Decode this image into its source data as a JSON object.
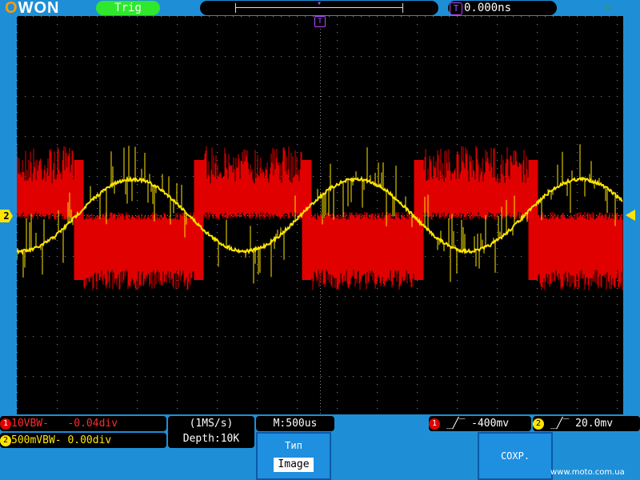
{
  "header": {
    "brand": "OWON",
    "trigger_status": "Trig",
    "trigger_position_badge": "T",
    "trigger_time": "0.000ns",
    "trigger_marker": "T"
  },
  "colors": {
    "ch1": "#e10000",
    "ch2": "#ffe600",
    "trigger": "#b14cff",
    "background": "#1e8fd6"
  },
  "screen": {
    "ch2_marker": "2",
    "ch1_waveform": "square wave with noise",
    "ch2_waveform": "sine wave with noise"
  },
  "channels": {
    "ch1": {
      "badge": "1",
      "text": "10VBW-",
      "offset": "-0.04div"
    },
    "ch2": {
      "badge": "2",
      "text": "500mVBW-",
      "offset": "0.00div"
    }
  },
  "acquisition": {
    "rate": "(1MS/s)",
    "depth": "Depth:10K",
    "timebase": "M:500us"
  },
  "triggers": [
    {
      "badge": "1",
      "edge_icon": "rising-edge-icon",
      "value": "-400mv"
    },
    {
      "badge": "2",
      "edge_icon": "rising-edge-icon",
      "value": "20.0mv"
    }
  ],
  "menu": {
    "type_title": "Тип",
    "type_value": "Image",
    "save_label": "СОХР."
  },
  "watermark": "www.moto.com.ua"
}
